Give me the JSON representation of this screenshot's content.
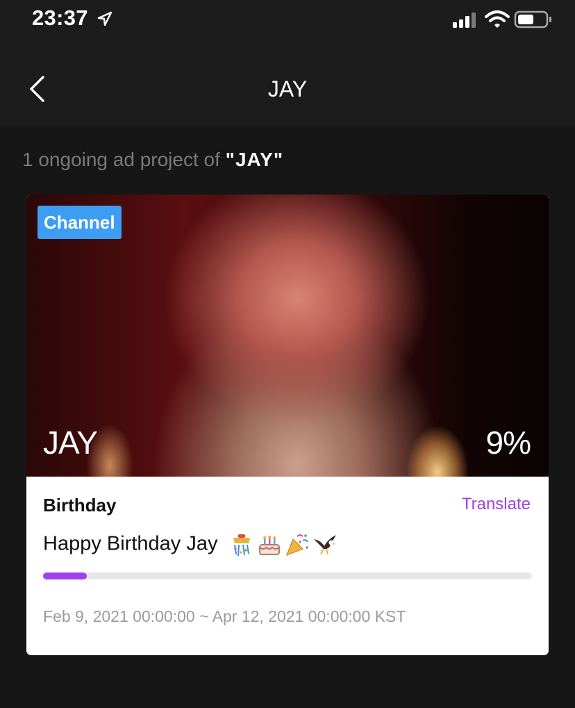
{
  "status_bar": {
    "time": "23:37"
  },
  "nav": {
    "title": "JAY"
  },
  "summary": {
    "prefix": "1 ongoing ad project of ",
    "highlight": "\"JAY\""
  },
  "project": {
    "badge": "Channel",
    "artist": "JAY",
    "percent_label": "9%",
    "progress": 0.09,
    "category": "Birthday",
    "translate_label": "Translate",
    "message": "Happy Birthday Jay",
    "message_emojis": [
      "confetti-ball-icon",
      "birthday-cake-icon",
      "party-popper-icon",
      "eagle-icon"
    ],
    "period": "Feb 9, 2021 00:00:00 ~ Apr 12, 2021 00:00:00 KST"
  },
  "colors": {
    "background": "#161616",
    "badge": "#3d9df2",
    "accent": "#a03ff0",
    "progress_track": "#e6e6e6"
  }
}
